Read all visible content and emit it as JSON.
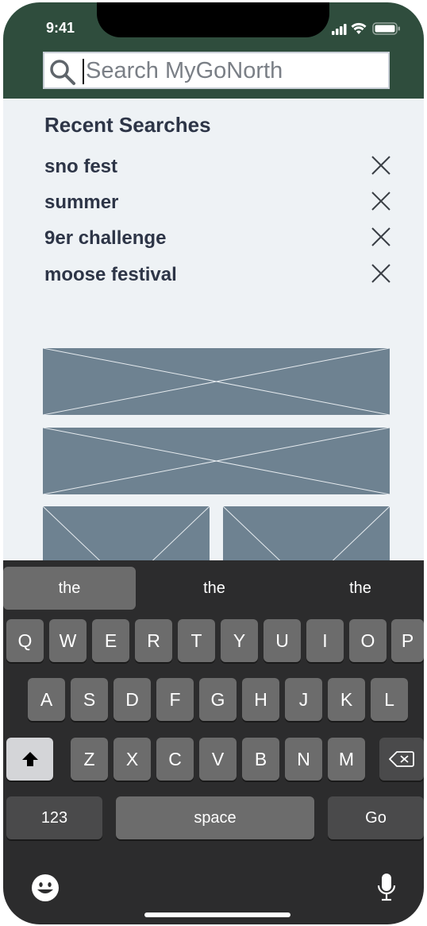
{
  "status_bar": {
    "time": "9:41"
  },
  "search": {
    "placeholder": "Search MyGoNorth",
    "value": ""
  },
  "recent": {
    "title": "Recent Searches",
    "items": [
      {
        "label": "sno fest"
      },
      {
        "label": "summer"
      },
      {
        "label": "9er challenge"
      },
      {
        "label": "moose festival"
      }
    ]
  },
  "colors": {
    "header": "#2f4d3d",
    "placeholder_image": "#6e8291",
    "keyboard": "#2c2c2d"
  },
  "keyboard": {
    "suggestions": [
      "the",
      "the",
      "the"
    ],
    "row1": [
      "Q",
      "W",
      "E",
      "R",
      "T",
      "Y",
      "U",
      "I",
      "O",
      "P"
    ],
    "row2": [
      "A",
      "S",
      "D",
      "F",
      "G",
      "H",
      "J",
      "K",
      "L"
    ],
    "row3": [
      "Z",
      "X",
      "C",
      "V",
      "B",
      "N",
      "M"
    ],
    "numbers_label": "123",
    "space_label": "space",
    "go_label": "Go"
  }
}
